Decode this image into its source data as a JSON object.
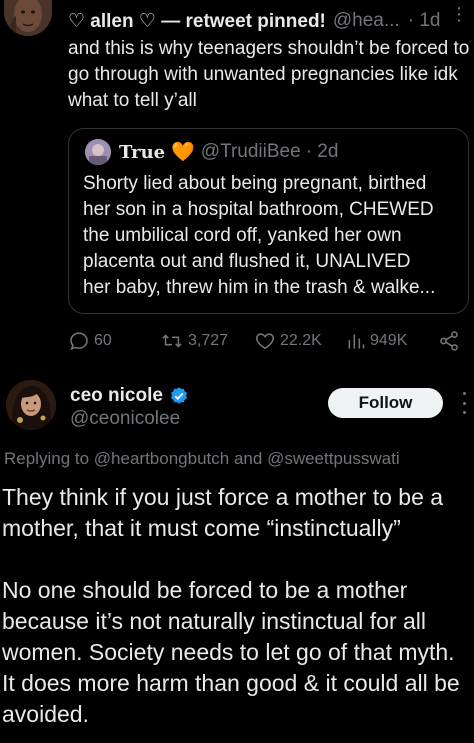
{
  "main_tweet": {
    "name": "♡ allen ♡ — retweet pinned!",
    "handle": "@hea...",
    "time": "· 1d",
    "text": "and this is why teenagers shouldn’t be forced to go through with unwanted pregnancies like idk what to tell y’all",
    "more_label": "⋮"
  },
  "quote": {
    "name": "True",
    "heart": "🧡",
    "handle": "@TrudiiBee",
    "time": "· 2d",
    "lines": [
      "Shorty lied about being pregnant, birthed",
      "her son in a hospital bathroom, CHEWED",
      "the umbilical cord off, yanked her own",
      "placenta out and flushed it, UNALIVED",
      "her baby, threw him in the trash & walke..."
    ]
  },
  "actions": {
    "replies": "60",
    "retweets": "3,727",
    "likes": "22.2K",
    "views": "949K"
  },
  "reply": {
    "name": "ceo nicole",
    "handle": "@ceonicolee",
    "follow_label": "Follow",
    "replying_prefix": "Replying to",
    "mention_1": "@heartbongbutch",
    "and_word": "and",
    "mention_2": "@sweettpusswati",
    "paragraph_1": "They think if you just force a mother to be a mother, that it must come “instinctually”",
    "paragraph_2": "No one should be forced to be a mother because it’s not naturally instinctual for all women. Society needs to let go of that myth. It does more harm than good & it could all be avoided."
  },
  "colors": {
    "background": "#000000",
    "text": "#e7e9ea",
    "secondary": "#71767b",
    "border": "#2f3336",
    "verified": "#1d9bf0",
    "follow_bg": "#eff3f4"
  }
}
